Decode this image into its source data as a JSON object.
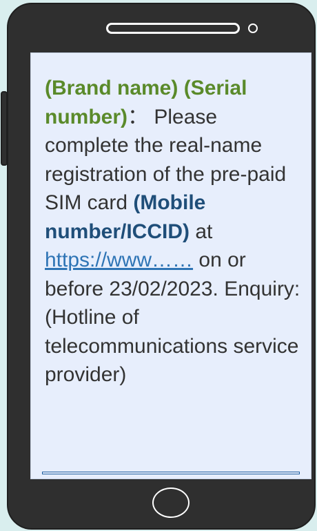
{
  "message": {
    "brand_serial": "(Brand name) (Serial number)",
    "separator": "：",
    "text_intro": "Please complete the real-name registration of the pre-paid SIM card",
    "mobile_iccid": "(Mobile number/ICCID)",
    "text_at": "at",
    "link": "https://www……",
    "text_deadline": "on or before 23/02/2023. Enquiry: (Hotline of telecommunications service provider)"
  },
  "colors": {
    "background": "#d9eeee",
    "phone_body": "#2f2f2f",
    "screen": "#e7eefc",
    "green_label": "#5a8a2a",
    "blue_label": "#1f4e79",
    "link": "#2e74b5"
  },
  "icons": {
    "speaker": "speaker-slot-icon",
    "camera": "front-camera-icon",
    "home": "home-button-icon"
  }
}
